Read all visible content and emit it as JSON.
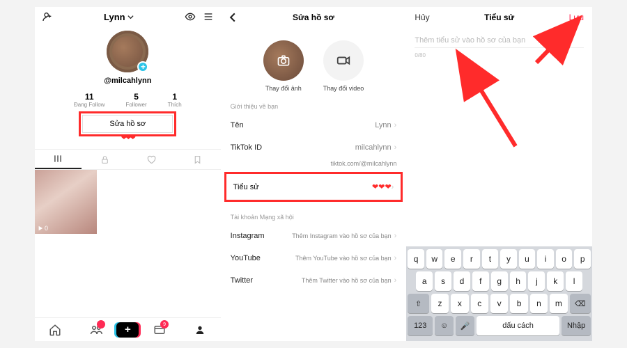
{
  "colors": {
    "accent": "#ff2b55",
    "highlight": "#ff2b2b",
    "cyan": "#2bc4e8"
  },
  "pane1": {
    "top_name": "Lynn",
    "handle": "@milcahlynn",
    "stats": [
      {
        "n": "11",
        "l": "Đang Follow"
      },
      {
        "n": "5",
        "l": "Follower"
      },
      {
        "n": "1",
        "l": "Thích"
      }
    ],
    "edit_label": "Sửa hồ sơ",
    "hearts": "❤❤❤",
    "video_views": "0"
  },
  "pane2": {
    "title": "Sửa hồ sơ",
    "change_photo": "Thay đổi ảnh",
    "change_video": "Thay đổi video",
    "section_about": "Giới thiệu về bạn",
    "rows": {
      "name_k": "Tên",
      "name_v": "Lynn",
      "id_k": "TikTok ID",
      "id_v": "milcahlynn",
      "url": "tiktok.com/@milcahlynn",
      "bio_k": "Tiểu sử",
      "bio_v": "❤❤❤"
    },
    "section_social": "Tài khoản Mạng xã hội",
    "social": [
      {
        "k": "Instagram",
        "v": "Thêm Instagram vào hồ sơ của bạn"
      },
      {
        "k": "YouTube",
        "v": "Thêm YouTube vào hồ sơ của bạn"
      },
      {
        "k": "Twitter",
        "v": "Thêm Twitter vào hồ sơ của bạn"
      }
    ]
  },
  "pane3": {
    "cancel": "Hủy",
    "title": "Tiểu sử",
    "save": "Lưu",
    "placeholder": "Thêm tiểu sử vào hồ sơ của bạn",
    "count": "0/80",
    "keyboard": {
      "r1": [
        "q",
        "w",
        "e",
        "r",
        "t",
        "y",
        "u",
        "i",
        "o",
        "p"
      ],
      "r2": [
        "a",
        "s",
        "d",
        "f",
        "g",
        "h",
        "j",
        "k",
        "l"
      ],
      "r3": [
        "z",
        "x",
        "c",
        "v",
        "b",
        "n",
        "m"
      ],
      "shift": "⇧",
      "del": "⌫",
      "num": "123",
      "emoji": "☺",
      "mic": "🎤",
      "space": "dấu cách",
      "enter": "Nhập"
    }
  }
}
